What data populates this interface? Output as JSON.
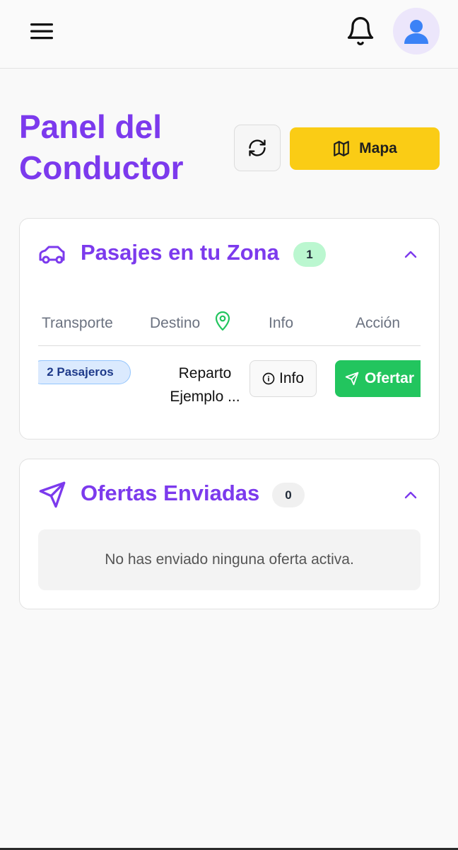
{
  "header": {
    "menu_icon": "hamburger-menu-icon",
    "notifications_icon": "bell-icon",
    "avatar_icon": "user-avatar-icon"
  },
  "page": {
    "title": "Panel del Conductor",
    "refresh_icon": "refresh-icon",
    "map_button_label": "Mapa",
    "map_icon": "map-icon"
  },
  "zone_section": {
    "title": "Pasajes en tu Zona",
    "count": "1",
    "icon": "car-icon",
    "collapse_icon": "chevron-up-icon",
    "columns": {
      "transporte": "Transporte",
      "destino": "Destino",
      "info": "Info",
      "accion": "Acción"
    },
    "rows": [
      {
        "transporte": "2 Pasajeros",
        "destino": "Reparto Ejemplo ...",
        "info_label": "Info",
        "action_label": "Ofertar"
      }
    ]
  },
  "offers_section": {
    "title": "Ofertas Enviadas",
    "count": "0",
    "icon": "send-icon",
    "collapse_icon": "chevron-up-icon",
    "empty_message": "No has enviado ninguna oferta activa."
  },
  "colors": {
    "brand_purple": "#7c3aed",
    "map_yellow": "#facc15",
    "offer_green": "#22c55e",
    "badge_green": "#bbf7d0"
  }
}
